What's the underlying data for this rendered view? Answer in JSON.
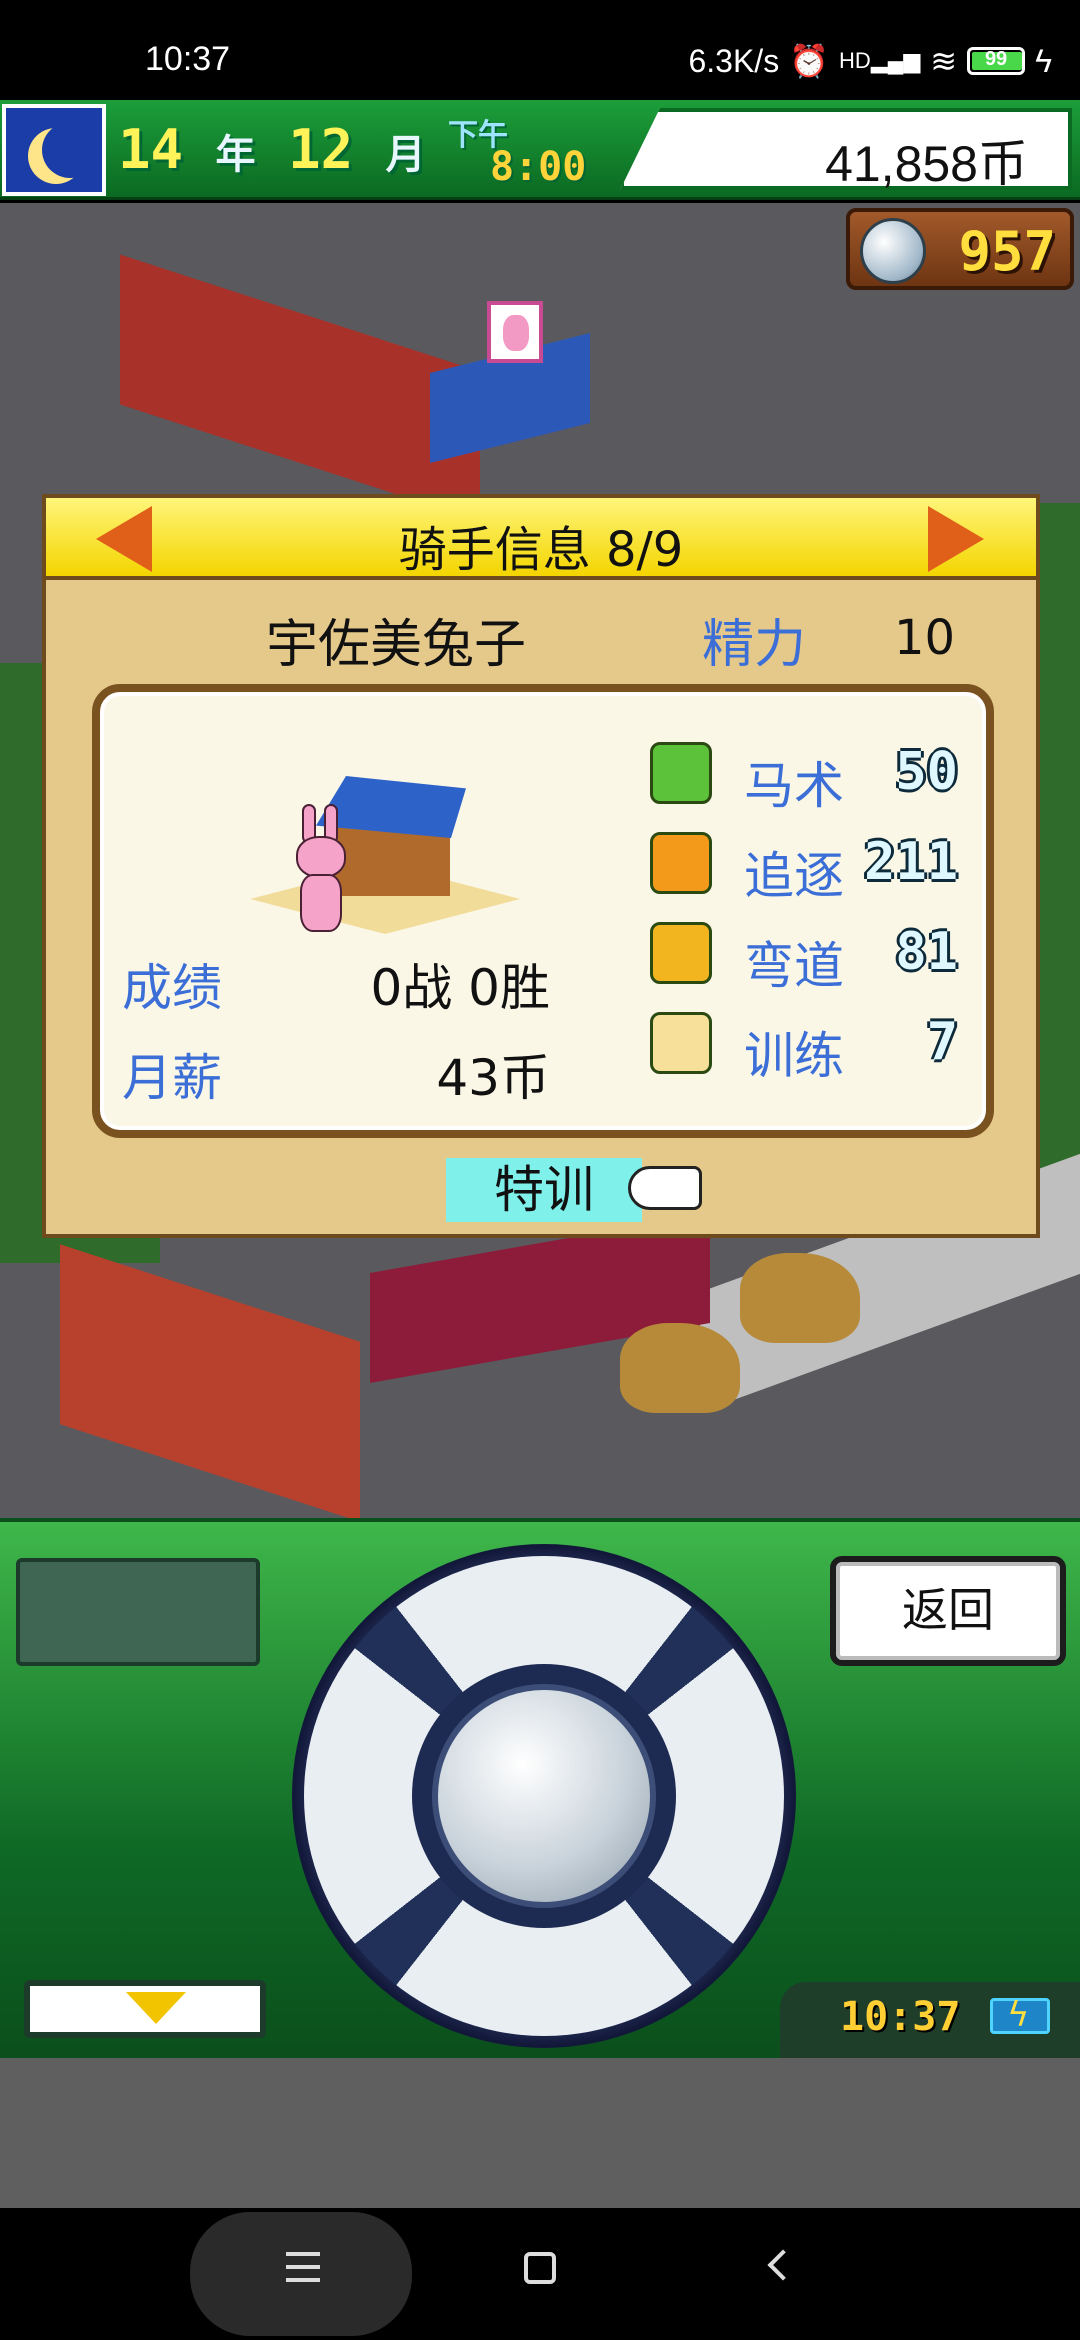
{
  "status_bar": {
    "time": "10:37",
    "network_speed": "6.3K/s",
    "signal_label": "HD",
    "battery_level": "99"
  },
  "hud": {
    "year": "14",
    "year_unit": "年",
    "month": "12",
    "month_unit": "月",
    "period": "下午",
    "clock": "8:00",
    "coins": "41,858币",
    "medals": "957"
  },
  "dialog": {
    "title": "骑手信息 8/9",
    "jockey_name": "宇佐美兔子",
    "energy_label": "精力",
    "energy_value": "10",
    "record_label": "成绩",
    "record_value": "0战 0胜",
    "salary_label": "月薪",
    "salary_value": "43币",
    "stats": [
      {
        "label": "马术",
        "value": "50",
        "icon": "horse-icon"
      },
      {
        "label": "追逐",
        "value": "211",
        "icon": "chase-arrows-icon"
      },
      {
        "label": "弯道",
        "value": "81",
        "icon": "curve-arrow-icon"
      },
      {
        "label": "训练",
        "value": "7",
        "icon": "whip-icon"
      }
    ],
    "special_training_button": "特训"
  },
  "controller": {
    "back_button": "返回",
    "clock": "10:37"
  },
  "colors": {
    "hud_green": "#1c9e3a",
    "dialog_header_yellow": "#f3d500",
    "label_blue": "#3b6ed6",
    "special_button_cyan": "#7ff0ea"
  }
}
